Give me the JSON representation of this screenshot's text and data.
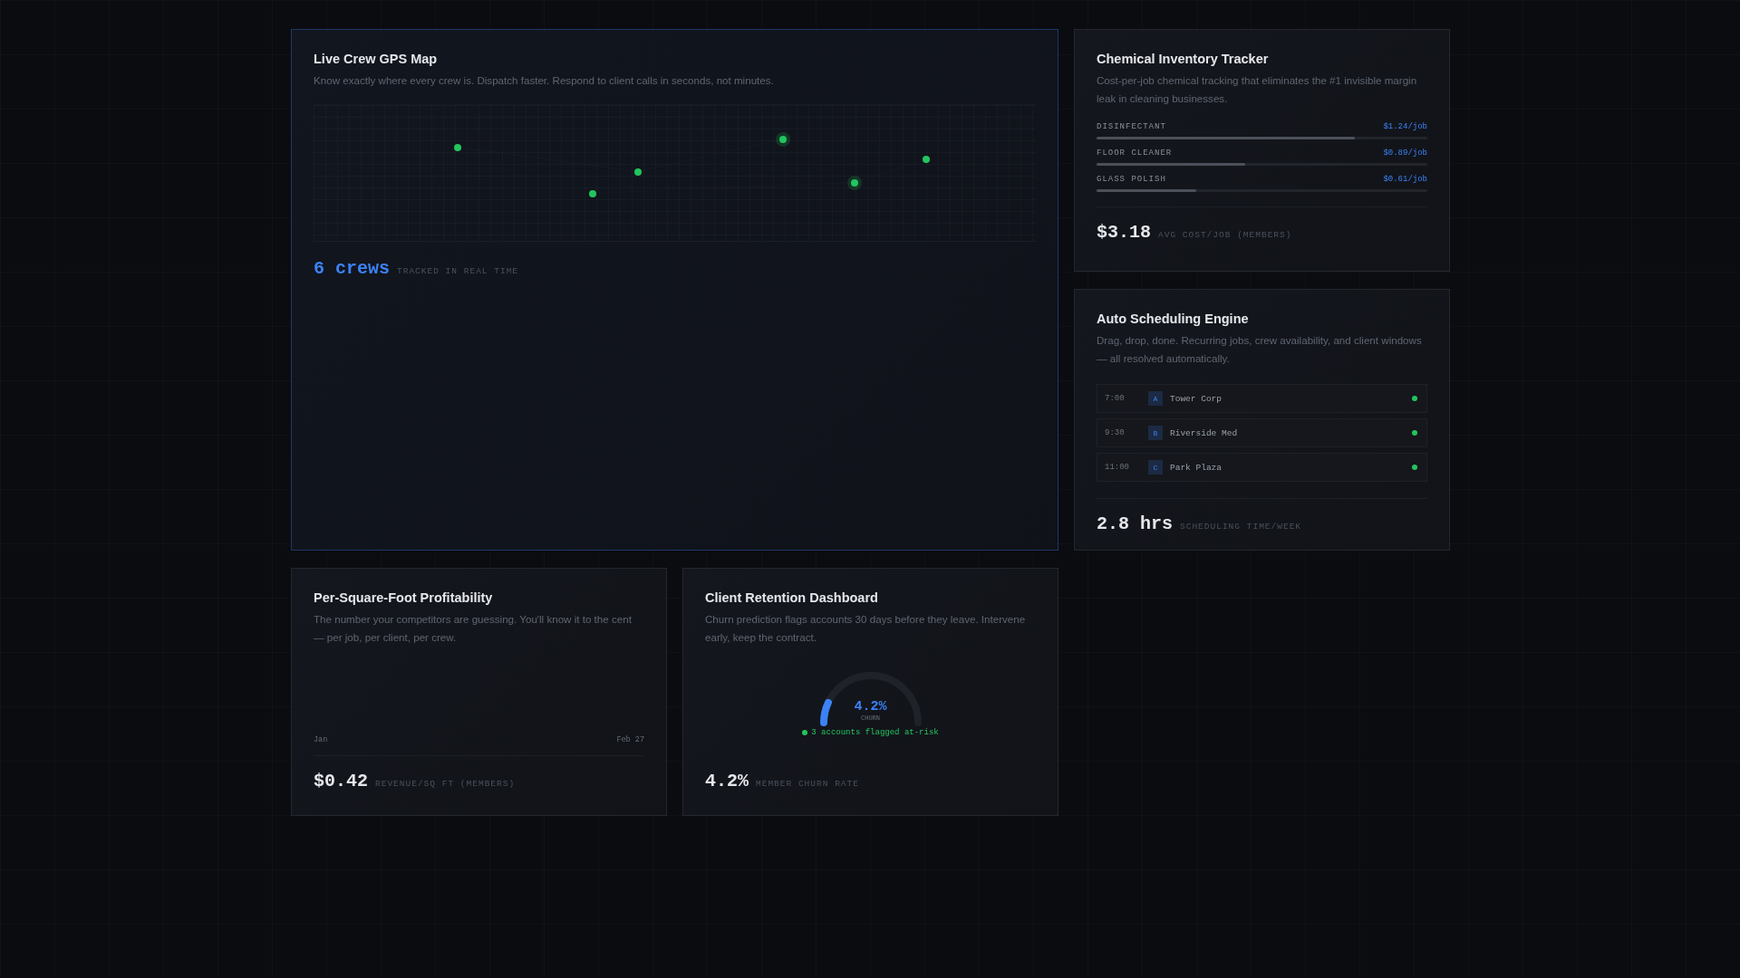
{
  "gps_map": {
    "title": "Live Crew GPS Map",
    "description": "Know exactly where every crew is. Dispatch faster. Respond to client calls in seconds, not minutes.",
    "stat_value": "6 crews",
    "stat_label": "TRACKED IN REAL TIME"
  },
  "chemical_inventory": {
    "title": "Chemical Inventory Tracker",
    "description": "Cost-per-job chemical tracking that eliminates the #1 invisible margin leak in cleaning businesses.",
    "items": [
      {
        "name": "DISINFECTANT",
        "cost": "$1.24/job",
        "level": 0.78
      },
      {
        "name": "FLOOR CLEANER",
        "cost": "$0.89/job",
        "level": 0.45
      },
      {
        "name": "GLASS POLISH",
        "cost": "$0.61/job",
        "level": 0.3
      }
    ],
    "stat_value": "$3.18",
    "stat_label": "AVG COST/JOB (MEMBERS)"
  },
  "auto_scheduling": {
    "title": "Auto Scheduling Engine",
    "description": "Drag, drop, done. Recurring jobs, crew availability, and client windows — all resolved automatically.",
    "jobs": [
      {
        "time": "7:00",
        "crew": "A",
        "client": "Tower Corp"
      },
      {
        "time": "9:30",
        "crew": "B",
        "client": "Riverside Med"
      },
      {
        "time": "11:00",
        "crew": "C",
        "client": "Park Plaza"
      }
    ],
    "stat_value": "2.8 hrs",
    "stat_label": "SCHEDULING TIME/WEEK"
  },
  "profitability": {
    "title": "Per-Square-Foot Profitability",
    "description": "The number your competitors are guessing. You'll know it to the cent — per job, per client, per crew.",
    "axis_start": "Jan",
    "axis_end": "Feb 27",
    "stat_value": "$0.42",
    "stat_label": "REVENUE/SQ FT (MEMBERS)"
  },
  "retention": {
    "title": "Client Retention Dashboard",
    "description": "Churn prediction flags accounts 30 days before they leave. Intervene early, keep the contract.",
    "gauge": {
      "value": "4.2%",
      "caption": "CHURN",
      "level": 0.14
    },
    "alert": "3 accounts flagged at-risk",
    "stat_value": "4.2%",
    "stat_label": "MEMBER CHURN RATE"
  }
}
